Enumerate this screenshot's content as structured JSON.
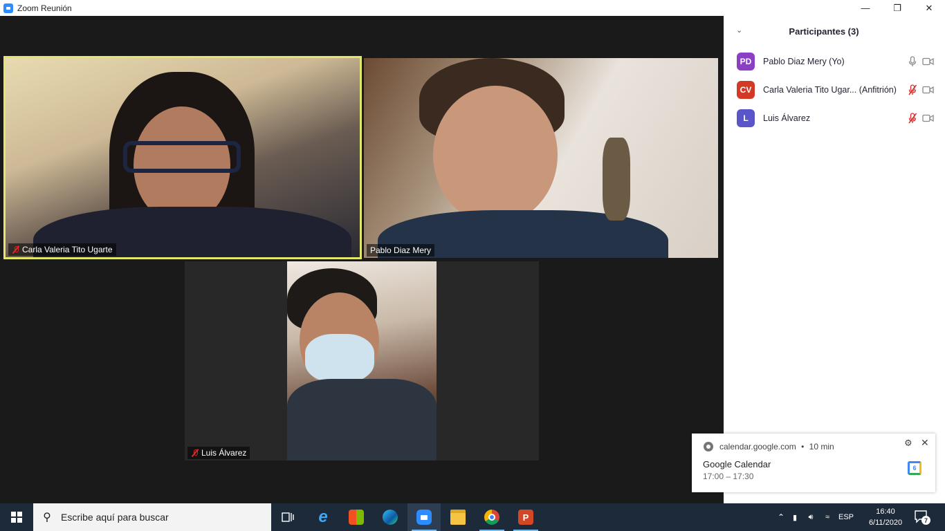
{
  "window": {
    "title": "Zoom Reunión",
    "minimize": "—",
    "restore": "❐",
    "close": "✕"
  },
  "gallery": {
    "tiles": [
      {
        "name": "Carla Valeria Tito Ugarte",
        "muted": true,
        "active_speaker": true
      },
      {
        "name": "Pablo Diaz Mery",
        "muted": false,
        "active_speaker": false
      },
      {
        "name": "Luis Álvarez",
        "muted": true,
        "active_speaker": false
      }
    ]
  },
  "participants": {
    "title": "Participantes (3)",
    "collapse_icon": "⌄",
    "list": [
      {
        "initials": "PD",
        "name": "Pablo Diaz Mery (Yo)",
        "color": "#8b3fc4",
        "muted": false
      },
      {
        "initials": "CV",
        "name": "Carla Valeria Tito Ugar... (Anfitrión)",
        "color": "#d13a25",
        "muted": true
      },
      {
        "initials": "L",
        "name": "Luis Álvarez",
        "color": "#5a56c9",
        "muted": true
      }
    ]
  },
  "notification": {
    "source": "calendar.google.com",
    "separator": "•",
    "age": "10 min",
    "title": "Google Calendar",
    "time": "17:00 – 17:30",
    "settings_icon": "gear-icon",
    "close_icon": "close-icon",
    "calendar_day": "6"
  },
  "taskbar": {
    "search_placeholder": "Escribe aquí para buscar",
    "language": "ESP",
    "time": "16:40",
    "date": "6/11/2020",
    "notification_count": "7"
  }
}
